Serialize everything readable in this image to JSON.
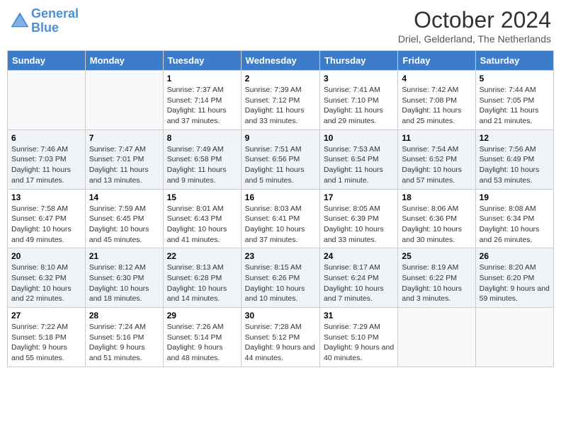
{
  "header": {
    "logo_line1": "General",
    "logo_line2": "Blue",
    "month": "October 2024",
    "location": "Driel, Gelderland, The Netherlands"
  },
  "days_of_week": [
    "Sunday",
    "Monday",
    "Tuesday",
    "Wednesday",
    "Thursday",
    "Friday",
    "Saturday"
  ],
  "weeks": [
    [
      {
        "day": "",
        "detail": ""
      },
      {
        "day": "",
        "detail": ""
      },
      {
        "day": "1",
        "detail": "Sunrise: 7:37 AM\nSunset: 7:14 PM\nDaylight: 11 hours and 37 minutes."
      },
      {
        "day": "2",
        "detail": "Sunrise: 7:39 AM\nSunset: 7:12 PM\nDaylight: 11 hours and 33 minutes."
      },
      {
        "day": "3",
        "detail": "Sunrise: 7:41 AM\nSunset: 7:10 PM\nDaylight: 11 hours and 29 minutes."
      },
      {
        "day": "4",
        "detail": "Sunrise: 7:42 AM\nSunset: 7:08 PM\nDaylight: 11 hours and 25 minutes."
      },
      {
        "day": "5",
        "detail": "Sunrise: 7:44 AM\nSunset: 7:05 PM\nDaylight: 11 hours and 21 minutes."
      }
    ],
    [
      {
        "day": "6",
        "detail": "Sunrise: 7:46 AM\nSunset: 7:03 PM\nDaylight: 11 hours and 17 minutes."
      },
      {
        "day": "7",
        "detail": "Sunrise: 7:47 AM\nSunset: 7:01 PM\nDaylight: 11 hours and 13 minutes."
      },
      {
        "day": "8",
        "detail": "Sunrise: 7:49 AM\nSunset: 6:58 PM\nDaylight: 11 hours and 9 minutes."
      },
      {
        "day": "9",
        "detail": "Sunrise: 7:51 AM\nSunset: 6:56 PM\nDaylight: 11 hours and 5 minutes."
      },
      {
        "day": "10",
        "detail": "Sunrise: 7:53 AM\nSunset: 6:54 PM\nDaylight: 11 hours and 1 minute."
      },
      {
        "day": "11",
        "detail": "Sunrise: 7:54 AM\nSunset: 6:52 PM\nDaylight: 10 hours and 57 minutes."
      },
      {
        "day": "12",
        "detail": "Sunrise: 7:56 AM\nSunset: 6:49 PM\nDaylight: 10 hours and 53 minutes."
      }
    ],
    [
      {
        "day": "13",
        "detail": "Sunrise: 7:58 AM\nSunset: 6:47 PM\nDaylight: 10 hours and 49 minutes."
      },
      {
        "day": "14",
        "detail": "Sunrise: 7:59 AM\nSunset: 6:45 PM\nDaylight: 10 hours and 45 minutes."
      },
      {
        "day": "15",
        "detail": "Sunrise: 8:01 AM\nSunset: 6:43 PM\nDaylight: 10 hours and 41 minutes."
      },
      {
        "day": "16",
        "detail": "Sunrise: 8:03 AM\nSunset: 6:41 PM\nDaylight: 10 hours and 37 minutes."
      },
      {
        "day": "17",
        "detail": "Sunrise: 8:05 AM\nSunset: 6:39 PM\nDaylight: 10 hours and 33 minutes."
      },
      {
        "day": "18",
        "detail": "Sunrise: 8:06 AM\nSunset: 6:36 PM\nDaylight: 10 hours and 30 minutes."
      },
      {
        "day": "19",
        "detail": "Sunrise: 8:08 AM\nSunset: 6:34 PM\nDaylight: 10 hours and 26 minutes."
      }
    ],
    [
      {
        "day": "20",
        "detail": "Sunrise: 8:10 AM\nSunset: 6:32 PM\nDaylight: 10 hours and 22 minutes."
      },
      {
        "day": "21",
        "detail": "Sunrise: 8:12 AM\nSunset: 6:30 PM\nDaylight: 10 hours and 18 minutes."
      },
      {
        "day": "22",
        "detail": "Sunrise: 8:13 AM\nSunset: 6:28 PM\nDaylight: 10 hours and 14 minutes."
      },
      {
        "day": "23",
        "detail": "Sunrise: 8:15 AM\nSunset: 6:26 PM\nDaylight: 10 hours and 10 minutes."
      },
      {
        "day": "24",
        "detail": "Sunrise: 8:17 AM\nSunset: 6:24 PM\nDaylight: 10 hours and 7 minutes."
      },
      {
        "day": "25",
        "detail": "Sunrise: 8:19 AM\nSunset: 6:22 PM\nDaylight: 10 hours and 3 minutes."
      },
      {
        "day": "26",
        "detail": "Sunrise: 8:20 AM\nSunset: 6:20 PM\nDaylight: 9 hours and 59 minutes."
      }
    ],
    [
      {
        "day": "27",
        "detail": "Sunrise: 7:22 AM\nSunset: 5:18 PM\nDaylight: 9 hours and 55 minutes."
      },
      {
        "day": "28",
        "detail": "Sunrise: 7:24 AM\nSunset: 5:16 PM\nDaylight: 9 hours and 51 minutes."
      },
      {
        "day": "29",
        "detail": "Sunrise: 7:26 AM\nSunset: 5:14 PM\nDaylight: 9 hours and 48 minutes."
      },
      {
        "day": "30",
        "detail": "Sunrise: 7:28 AM\nSunset: 5:12 PM\nDaylight: 9 hours and 44 minutes."
      },
      {
        "day": "31",
        "detail": "Sunrise: 7:29 AM\nSunset: 5:10 PM\nDaylight: 9 hours and 40 minutes."
      },
      {
        "day": "",
        "detail": ""
      },
      {
        "day": "",
        "detail": ""
      }
    ]
  ]
}
